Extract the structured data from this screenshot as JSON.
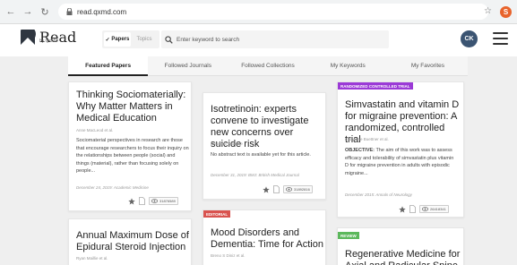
{
  "browser": {
    "url": "read.qxmd.com"
  },
  "header": {
    "logo_text": "Read",
    "logo_sub": "by QxMD",
    "toggle_active": "Papers",
    "toggle_inactive": "Topics",
    "search_placeholder": "Enter keyword to search",
    "avatar_initials": "CK",
    "extension_badge": "S"
  },
  "tabs": [
    {
      "label": "Featured Papers"
    },
    {
      "label": "Followed Journals"
    },
    {
      "label": "Followed Collections"
    },
    {
      "label": "My Keywords"
    },
    {
      "label": "My Favorites"
    }
  ],
  "cards": [
    {
      "title": "Thinking Sociomaterially: Why Matter Matters in Medical Education",
      "author": "Anne MacLeod et al.",
      "abstract": "Sociomaterial perspectives in research are those that encourage researchers to focus their inquiry on the relationships between people (social) and things (material), rather than focusing solely on people...",
      "meta": "December 24, 2019: Academic Medicine",
      "views": "31876589"
    },
    {
      "title": "Isotretinoin: experts convene to investigate new concerns over suicide risk",
      "author": "Elisabeth Mahase",
      "abstract": "No abstract text is available yet for this article.",
      "meta": "December 31, 2019: BMJ: British Medical Journal",
      "views": "31892816"
    },
    {
      "tag": "RANDOMIZED CONTROLLED TRIAL",
      "title": "Simvastatin and vitamin D for migraine prevention: A randomized, controlled trial",
      "author": "Catherine Buettner et al.",
      "abstract_label": "OBJECTIVE:",
      "abstract": " The aim of this work was to assess efficacy and tolerability of simvastatin plus vitamin D for migraine prevention in adults with episodic migraine...",
      "meta": "December 2015: Annals of Neurology",
      "views": "26418341"
    },
    {
      "title": "Annual Maximum Dose of Epidural Steroid Injection",
      "author": "Ryan Maillie et al."
    },
    {
      "tag": "EDITORIAL",
      "title": "Mood Disorders and Dementia: Time for Action",
      "author": "Breno S Diniz et al."
    },
    {
      "tag": "REVIEW",
      "title": "Regenerative Medicine for Axial and Radicular Spine"
    }
  ],
  "colors": {
    "tag_rct": "#9b3ad6",
    "tag_editorial": "#d9534f",
    "tag_review": "#5cb85c",
    "avatar": "#3b5472"
  }
}
